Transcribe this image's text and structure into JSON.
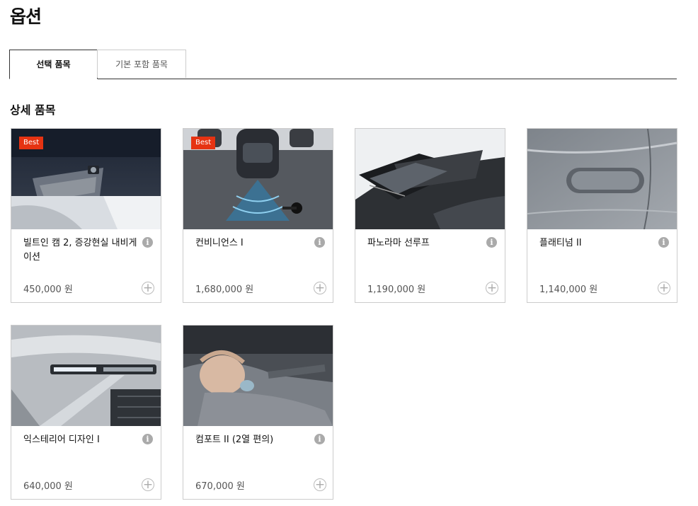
{
  "page": {
    "title": "옵션"
  },
  "tabs": [
    {
      "label": "선택 품목",
      "active": true
    },
    {
      "label": "기본 포함 품목",
      "active": false
    }
  ],
  "section": {
    "title": "상세 품목"
  },
  "colors": {
    "badge": "#e63312",
    "border": "#cccccc"
  },
  "options": [
    {
      "name": "빌트인 캠 2, 증강현실 내비게이션",
      "price": "450,000 원",
      "badge": "Best",
      "image": "builtin-cam"
    },
    {
      "name": "컨비니언스 I",
      "price": "1,680,000 원",
      "badge": "Best",
      "image": "parking-sensor"
    },
    {
      "name": "파노라마 선루프",
      "price": "1,190,000 원",
      "badge": "",
      "image": "sunroof"
    },
    {
      "name": "플래티넘 II",
      "price": "1,140,000 원",
      "badge": "",
      "image": "door-handle"
    },
    {
      "name": "익스테리어 디자인 I",
      "price": "640,000 원",
      "badge": "",
      "image": "headlamp"
    },
    {
      "name": "컴포트 II (2열 편의)",
      "price": "670,000 원",
      "badge": "",
      "image": "baby-seat"
    }
  ],
  "icons": {
    "info": "info-icon",
    "add": "plus-circle-icon"
  }
}
